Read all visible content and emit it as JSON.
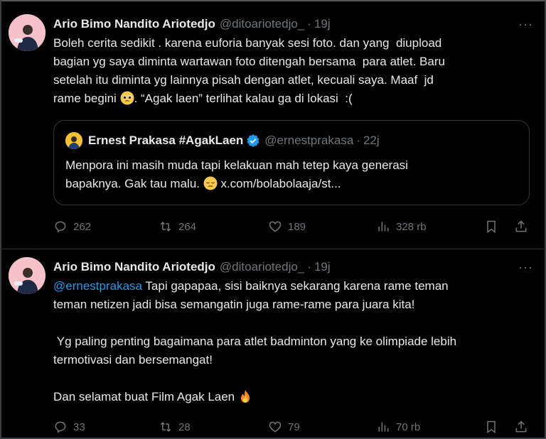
{
  "tweets": [
    {
      "author_name": "Ario Bimo Nandito Ariotedjo",
      "author_handle": "@ditoariotedjo_",
      "separator": "·",
      "time": "19j",
      "more_label": "···",
      "text_lines": [
        "Boleh cerita sedikit . karena euforia banyak sesi foto. dan yang  diupload",
        "bagian yg saya diminta wartawan foto ditengah bersama  para atlet. Baru",
        "setelah itu diminta yg lainnya pisah dengan atlet, kecuali saya. Maaf  jd"
      ],
      "text_line4_before": "rame begini ",
      "text_line4_after": ". “Agak laen” terlihat kalau ga di lokasi  :(",
      "quote": {
        "author_name": "Ernest Prakasa #AgakLaen",
        "author_handle": "@ernestprakasa",
        "separator": "·",
        "time": "22j",
        "line1": "Menpora ini masih muda tapi kelakuan mah tetep kaya generasi",
        "line2_before": "bapaknya. Gak tau malu. ",
        "line2_after": " x.com/bolabolaaja/st..."
      },
      "stats": {
        "replies": "262",
        "reposts": "264",
        "likes": "189",
        "views": "328 rb"
      }
    },
    {
      "author_name": "Ario Bimo Nandito Ariotedjo",
      "author_handle": "@ditoariotedjo_",
      "separator": "·",
      "time": "19j",
      "more_label": "···",
      "mention": "@ernestprakasa",
      "line1_after_mention": " Tapi gapapaa, sisi baiknya sekarang karena rame teman",
      "line2": "teman netizen jadi bisa semangatin juga rame-rame para juara kita!",
      "line3": " Yg paling penting bagaimana para atlet badminton yang ke olimpiade lebih",
      "line4": "termotivasi dan bersemangat!",
      "line5": "Dan selamat buat Film Agak Laen ",
      "stats": {
        "replies": "33",
        "reposts": "28",
        "likes": "79",
        "views": "70 rb"
      }
    }
  ]
}
